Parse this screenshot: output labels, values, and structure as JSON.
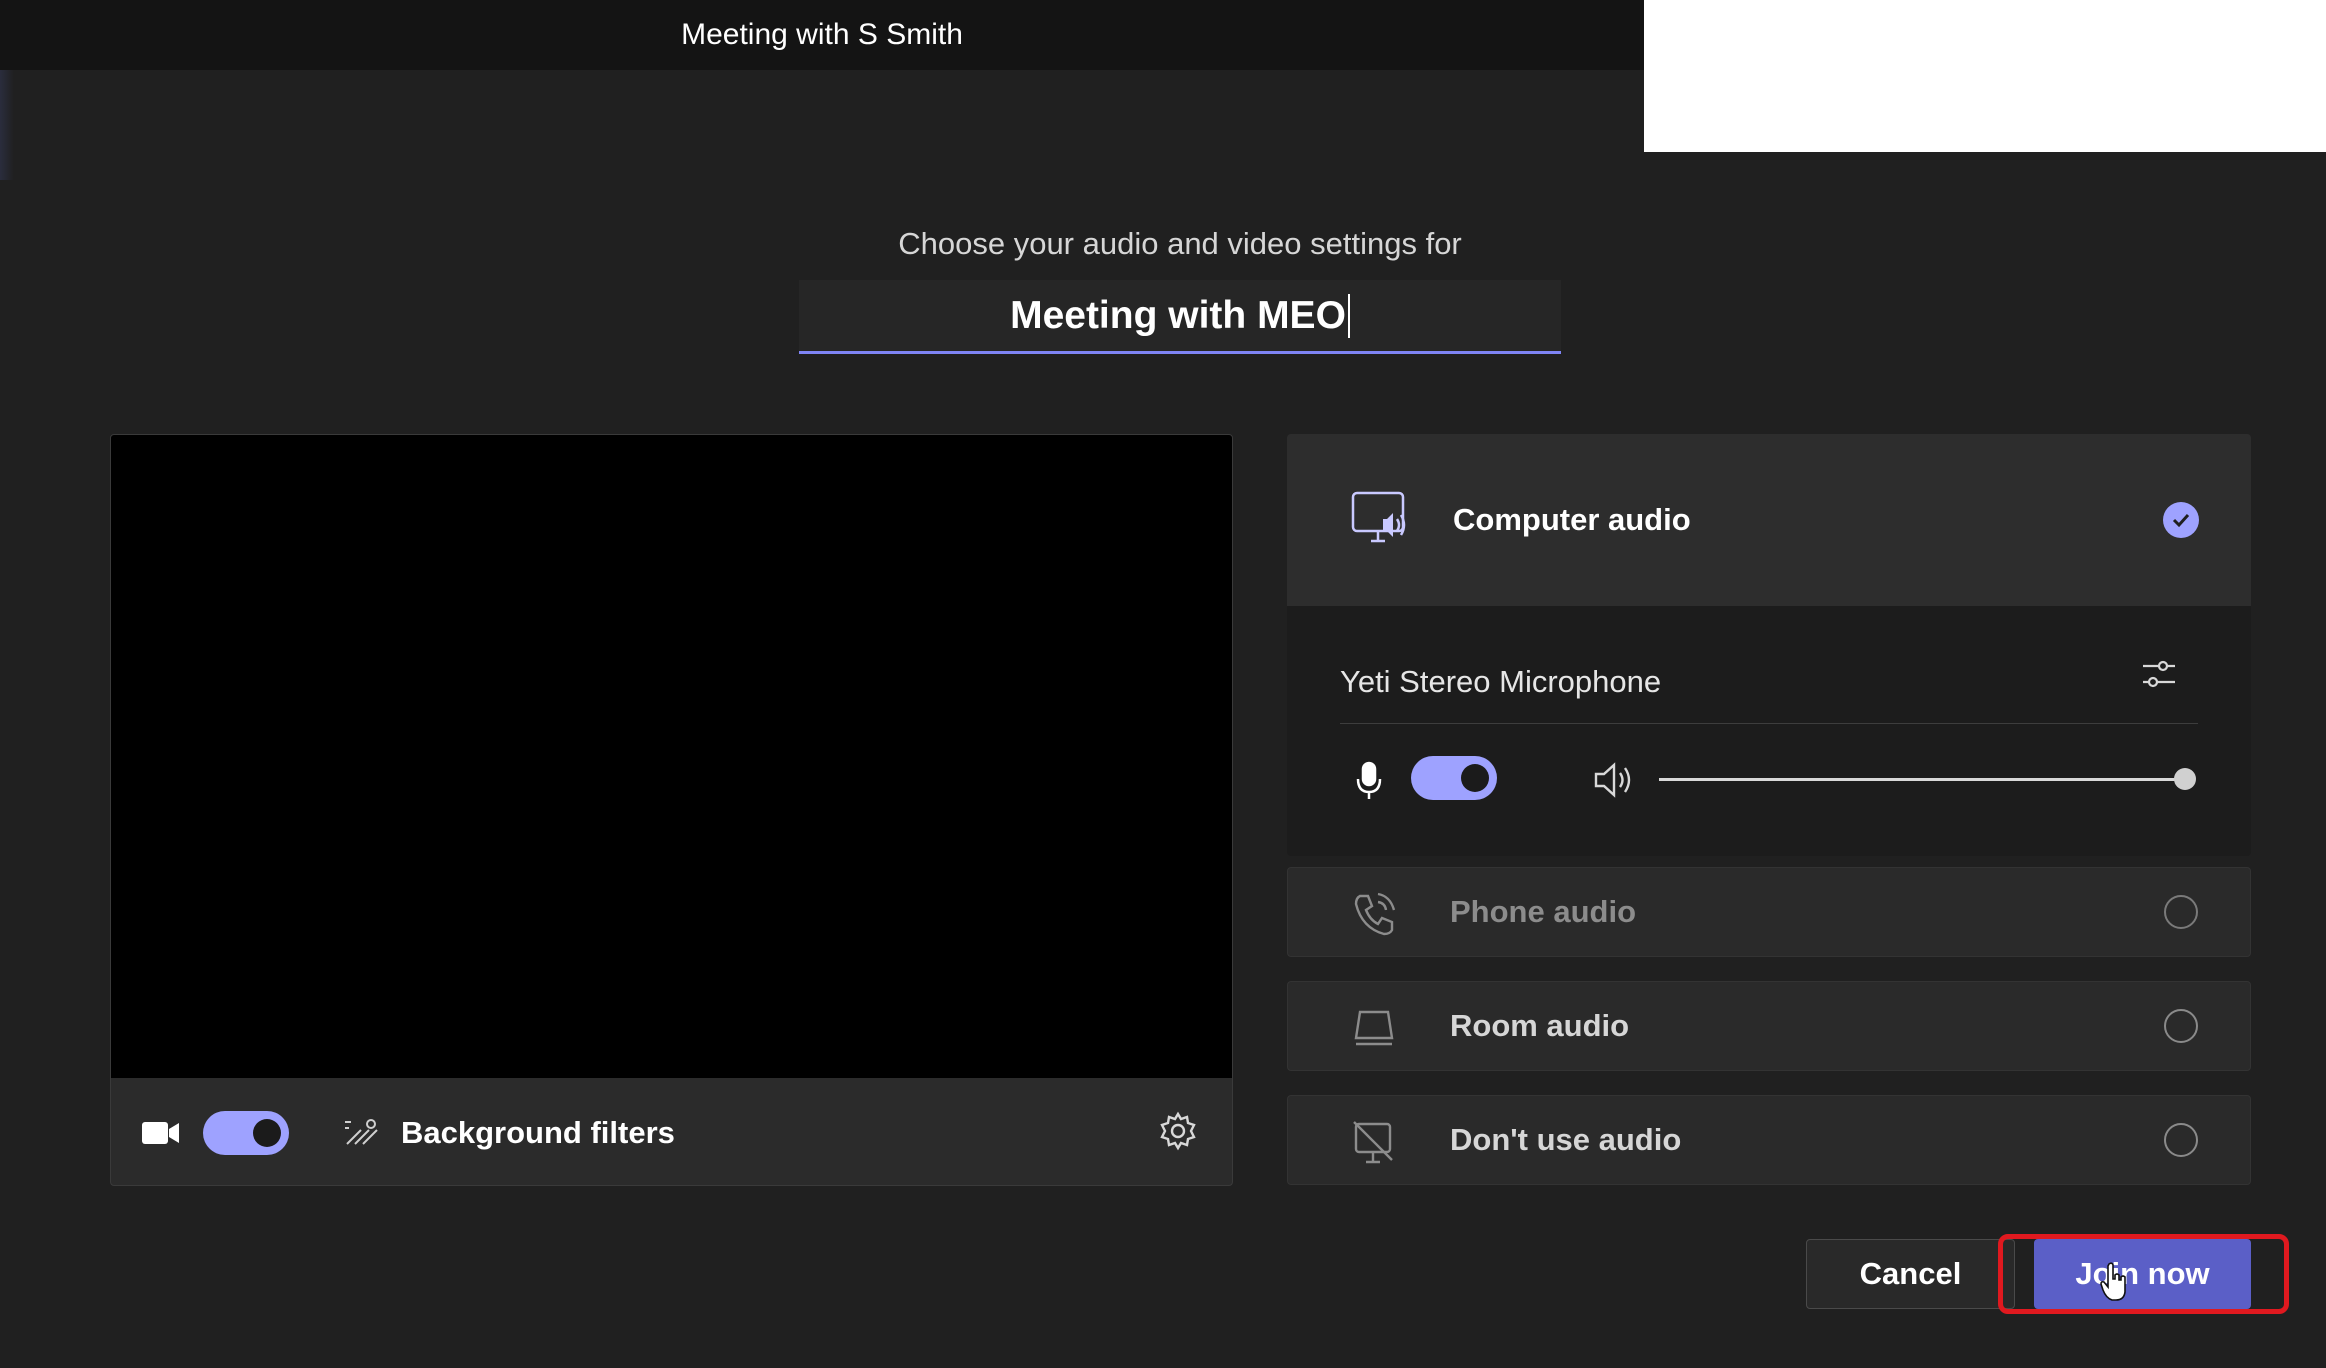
{
  "window": {
    "title": "Meeting with S Smith"
  },
  "prejoin": {
    "subtitle": "Choose your audio and video settings for",
    "meeting_name": "Meeting with MEO"
  },
  "video": {
    "camera_icon": "video-camera-icon",
    "camera_on": true,
    "background_filters_icon": "background-filters-icon",
    "background_filters_label": "Background filters",
    "settings_icon": "gear-icon"
  },
  "audio": {
    "computer_audio": {
      "label": "Computer audio",
      "icon": "computer-audio-icon",
      "selected": true
    },
    "device": {
      "microphone_name": "Yeti Stereo Microphone",
      "settings_icon": "sliders-icon",
      "mic_icon": "microphone-icon",
      "mic_on": true,
      "speaker_icon": "speaker-icon",
      "volume": 1.0
    },
    "options": [
      {
        "label": "Phone audio",
        "icon": "phone-audio-icon",
        "selected": false
      },
      {
        "label": "Room audio",
        "icon": "room-audio-icon",
        "selected": false
      },
      {
        "label": "Don't use audio",
        "icon": "no-audio-icon",
        "selected": false
      }
    ]
  },
  "actions": {
    "cancel": "Cancel",
    "join": "Join now"
  },
  "colors": {
    "accent": "#7f85f5",
    "primary_button": "#5b5fc7",
    "highlight": "#e0191f"
  }
}
